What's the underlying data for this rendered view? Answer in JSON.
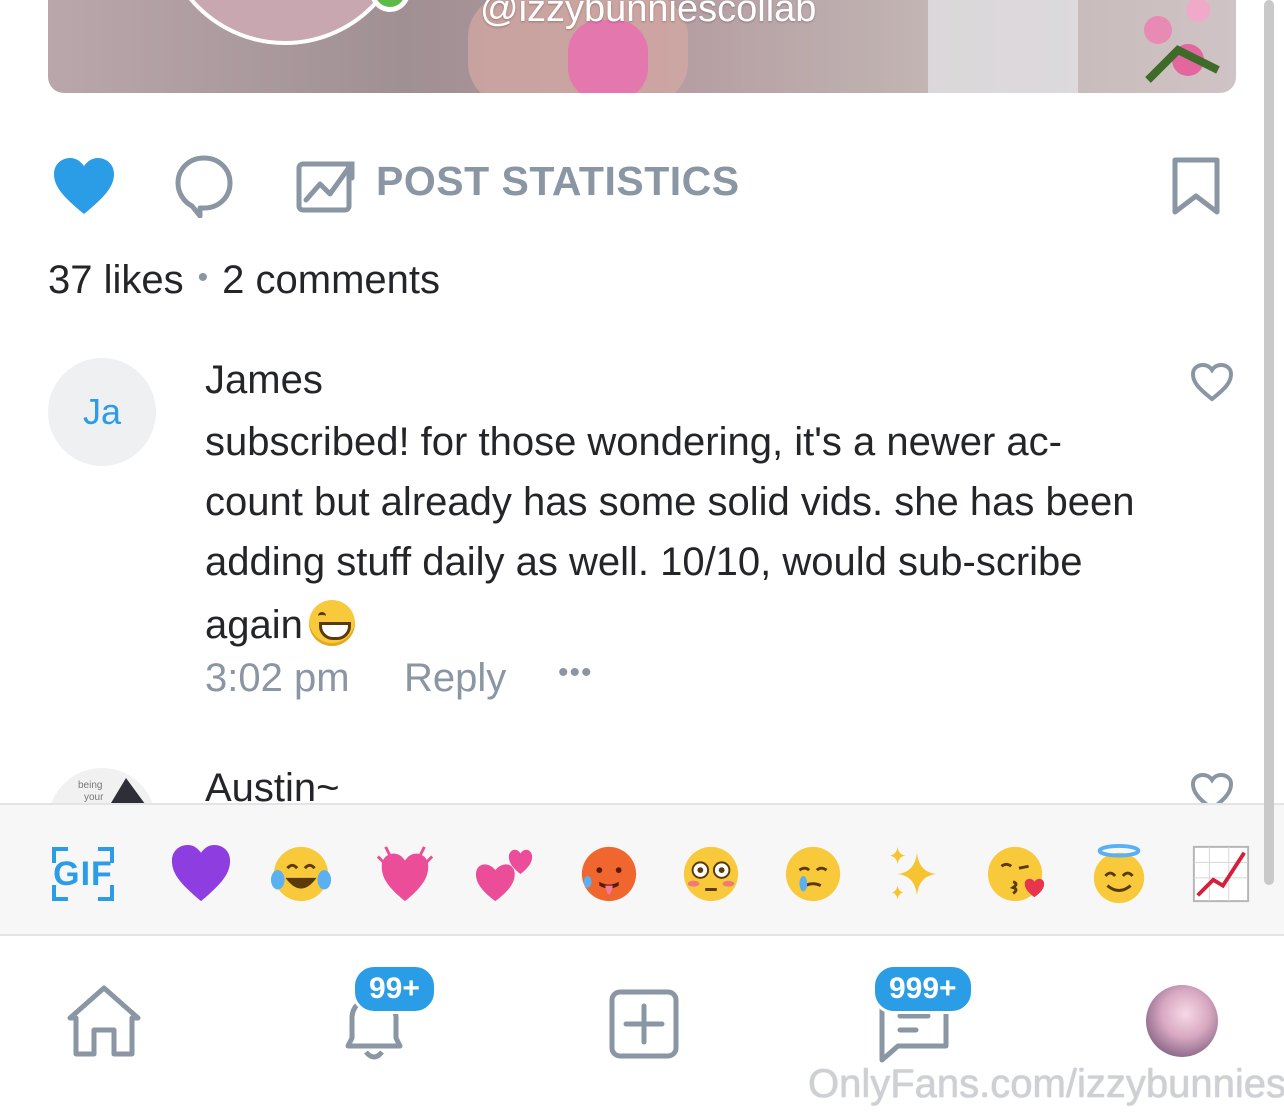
{
  "post": {
    "handle": "@izzybunniescollab",
    "stats_label": "POST STATISTICS",
    "likes": "37 likes",
    "separator": "•",
    "comments": "2 comments",
    "liked": true
  },
  "comments": [
    {
      "avatar_initials": "Ja",
      "author": "James",
      "text": "subscribed! for those wondering, it's a newer ac-count but already has some solid vids. she has been adding stuff daily as well. 10/10, would sub-scribe again",
      "time": "3:02 pm",
      "reply_label": "Reply",
      "more_label": "•••"
    },
    {
      "author": "Austin~"
    }
  ],
  "emoji_bar": {
    "gif_label": "GIF",
    "emojis": [
      "purple-heart",
      "tears-of-joy",
      "growing-heart",
      "two-hearts",
      "hot-face",
      "flushed-face",
      "face-holding-back-tears",
      "sparkles",
      "face-blowing-kiss",
      "smiling-face-with-halo",
      "chart-increasing"
    ]
  },
  "nav": {
    "notifications_badge": "99+",
    "messages_badge": "999+"
  },
  "watermark": "OnlyFans.com/izzybunnies",
  "colors": {
    "accent": "#2b9ce6",
    "muted": "#8a96a3",
    "text": "#242529"
  }
}
